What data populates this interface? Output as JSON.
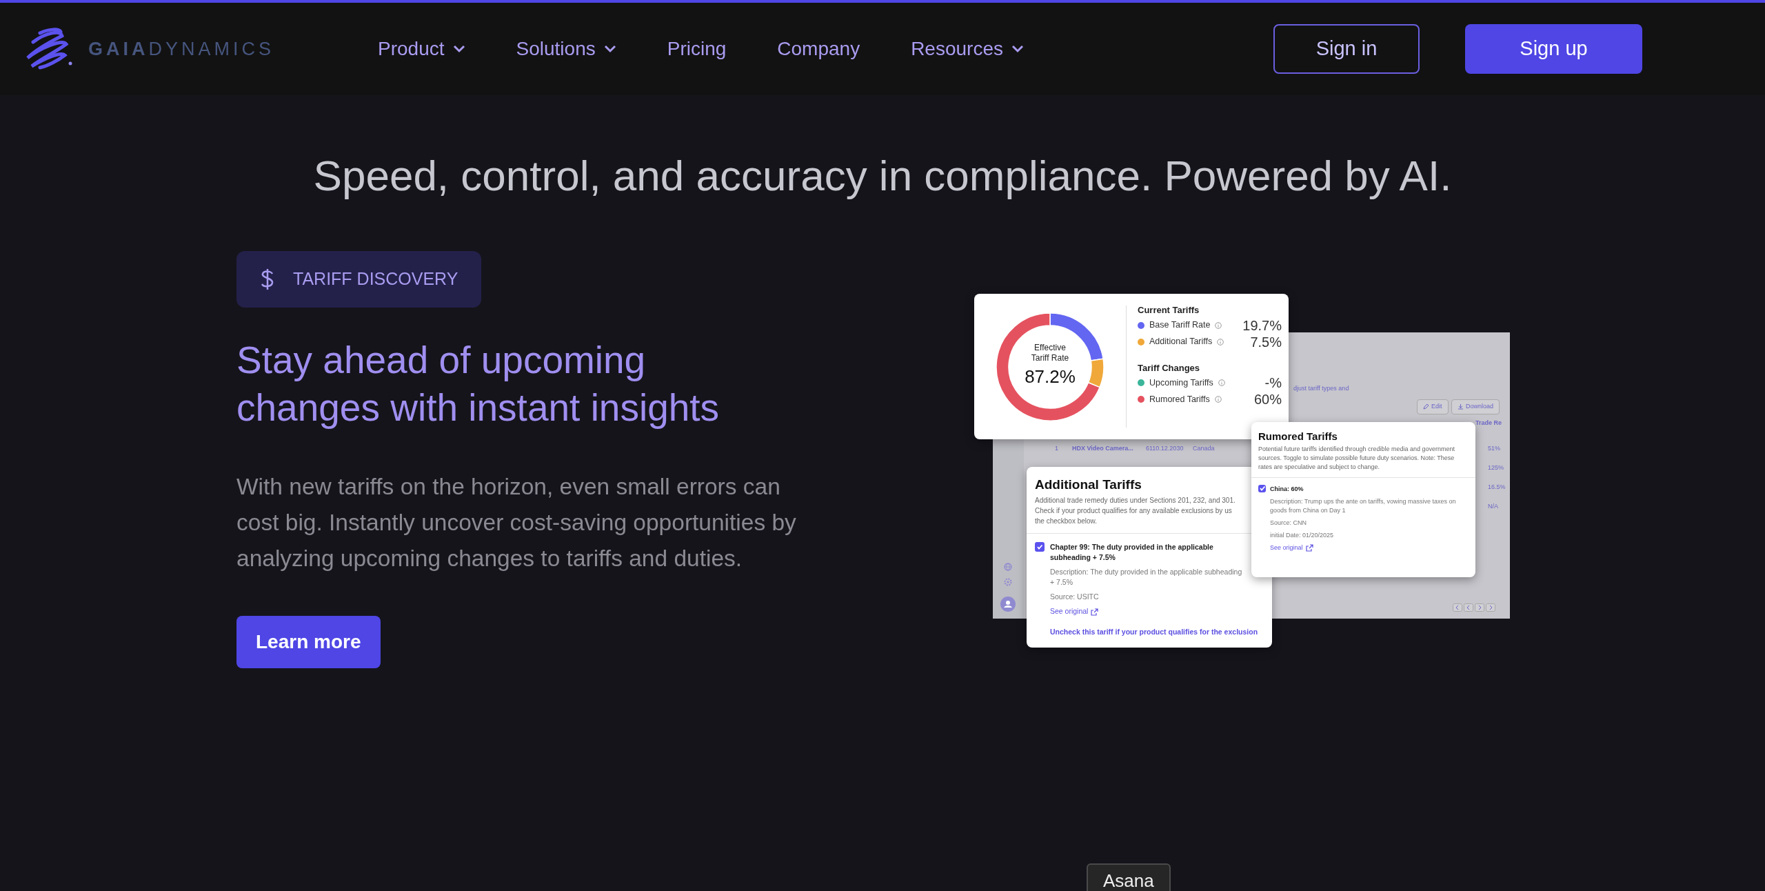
{
  "navbar": {
    "logo_text": {
      "bold": "GAIA",
      "light": "DYNAMICS"
    },
    "items": [
      {
        "label": "Product",
        "dropdown": true
      },
      {
        "label": "Solutions",
        "dropdown": true
      },
      {
        "label": "Pricing",
        "dropdown": false
      },
      {
        "label": "Company",
        "dropdown": false
      },
      {
        "label": "Resources",
        "dropdown": true
      }
    ],
    "sign_in": "Sign in",
    "sign_up": "Sign up"
  },
  "headline": "Speed, control, and accuracy in compliance. Powered by AI.",
  "feature": {
    "badge": "TARIFF DISCOVERY",
    "title": "Stay ahead of upcoming changes with instant insights",
    "text": "With new tariffs on the horizon, even small errors can cost big. Instantly uncover cost-saving opportunities by analyzing upcoming changes to tariffs and duties.",
    "button": "Learn more"
  },
  "mockup": {
    "rate_card": {
      "center_label": "Effective Tariff Rate",
      "center_value": "87.2%",
      "chart_data": {
        "type": "donut",
        "values": [
          22.6,
          8.6,
          68.8
        ]
      },
      "groups": [
        {
          "title": "Current Tariffs",
          "items": [
            {
              "label": "Base Tariff Rate",
              "value": "19.7%",
              "color": "#6366f1"
            },
            {
              "label": "Additional Tariffs",
              "value": "7.5%",
              "color": "#f0a83a"
            }
          ]
        },
        {
          "title": "Tariff Changes",
          "items": [
            {
              "label": "Upcoming Tariffs",
              "value": "-%",
              "color": "#3bb59a"
            },
            {
              "label": "Rumored Tariffs",
              "value": "60%",
              "color": "#e5525f"
            }
          ]
        }
      ]
    },
    "background_panel": {
      "subtitle": "djust tariff types and",
      "buttons": [
        "Edit",
        "Download"
      ],
      "column_header": "Trade Re",
      "row": [
        "1",
        "HDX Video Camera...",
        "6110.12.2030",
        "Canada"
      ],
      "column_values": [
        "51%",
        "125%",
        "16.5%",
        "N/A"
      ]
    },
    "additional_card": {
      "title": "Additional Tariffs",
      "text": "Additional trade remedy duties under Sections 201, 232, and 301. Check if your product qualifies for any available exclusions by us the checkbox below.",
      "item": {
        "checked": true,
        "label": "Chapter 99: The duty provided in the applicable subheading + 7.5%",
        "description": "Description: The duty provided in the applicable subheading + 7.5%",
        "source": "Source: USITC",
        "link": "See original"
      },
      "footer_link": "Uncheck this tariff if your product qualifies for the exclusion"
    },
    "rumored_card": {
      "title": "Rumored Tariffs",
      "text": "Potential future tariffs identified through credible media and government sources. Toggle to simulate possible future duty scenarios. Note: These rates are speculative and subject to change.",
      "item": {
        "checked": true,
        "label": "China: 60%",
        "description": "Description: Trump ups the ante on tariffs, vowing massive taxes on goods from China on Day 1",
        "source": "Source: CNN",
        "date": "initial Date: 01/20/2025",
        "link": "See original"
      }
    }
  },
  "tooltip": "Asana"
}
